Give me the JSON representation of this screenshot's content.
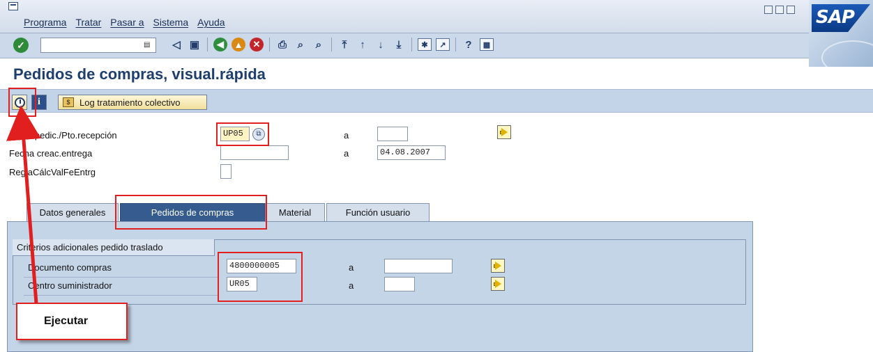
{
  "menu": {
    "items": [
      "Programa",
      "Tratar",
      "Pasar a",
      "Sistema",
      "Ayuda"
    ]
  },
  "window": {
    "logo_text": "SAP"
  },
  "title": "Pedidos de compras, visual.rápida",
  "app_toolbar": {
    "info_label": "i",
    "log_label": "Log tratamiento colectivo"
  },
  "form": {
    "rows": [
      {
        "label": "Pto.expedic./Pto.recepción",
        "from": "UP05",
        "to": ""
      },
      {
        "label": "Fecha creac.entrega",
        "from": "",
        "to": "04.08.2007"
      },
      {
        "label": "ReglaCálcValFeEntrg",
        "from": ""
      }
    ],
    "a_label": "a"
  },
  "tabs": [
    {
      "label": "Datos generales",
      "active": false
    },
    {
      "label": "Pedidos de compras",
      "active": true
    },
    {
      "label": "Material",
      "active": false
    },
    {
      "label": "Función usuario",
      "active": false
    }
  ],
  "group": {
    "title": "Criterios adicionales pedido traslado",
    "rows": [
      {
        "label": "Documento compras",
        "from": "4800000005",
        "to": ""
      },
      {
        "label": "Centro suministrador",
        "from": "UR05",
        "to": ""
      }
    ]
  },
  "annotation": {
    "callout_text": "Ejecutar"
  },
  "colors": {
    "title": "#1e3e6e",
    "annotation_red": "#e11f1f",
    "active_tab": "#365b8f"
  }
}
